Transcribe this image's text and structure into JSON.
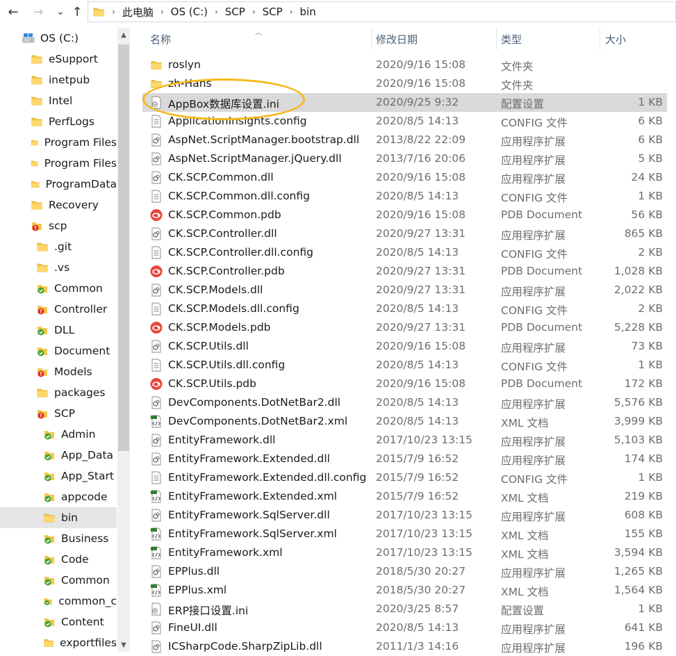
{
  "nav": {
    "back_icon": "←",
    "forward_icon": "→",
    "recent_icon": "⌄",
    "up_icon": "↑"
  },
  "address": {
    "segments": [
      "此电脑",
      "OS (C:)",
      "SCP",
      "SCP",
      "bin"
    ]
  },
  "tree": {
    "items": [
      {
        "label": "OS (C:)",
        "icon": "drive-icon",
        "indent": 0
      },
      {
        "label": "eSupport",
        "icon": "folder-icon",
        "indent": 1
      },
      {
        "label": "inetpub",
        "icon": "folder-icon",
        "indent": 1
      },
      {
        "label": "Intel",
        "icon": "folder-icon",
        "indent": 1
      },
      {
        "label": "PerfLogs",
        "icon": "folder-icon",
        "indent": 1
      },
      {
        "label": "Program Files",
        "icon": "folder-icon",
        "indent": 1
      },
      {
        "label": "Program Files",
        "icon": "folder-icon",
        "indent": 1
      },
      {
        "label": "ProgramData",
        "icon": "folder-icon",
        "indent": 1
      },
      {
        "label": "Recovery",
        "icon": "folder-icon",
        "indent": 1
      },
      {
        "label": "scp",
        "icon": "folder-red-icon",
        "indent": 1
      },
      {
        "label": ".git",
        "icon": "folder-icon",
        "indent": 2
      },
      {
        "label": ".vs",
        "icon": "folder-icon",
        "indent": 2
      },
      {
        "label": "Common",
        "icon": "folder-green-icon",
        "indent": 2
      },
      {
        "label": "Controller",
        "icon": "folder-red-icon",
        "indent": 2
      },
      {
        "label": "DLL",
        "icon": "folder-green-icon",
        "indent": 2
      },
      {
        "label": "Document",
        "icon": "folder-green-icon",
        "indent": 2
      },
      {
        "label": "Models",
        "icon": "folder-red-icon",
        "indent": 2
      },
      {
        "label": "packages",
        "icon": "folder-icon",
        "indent": 2
      },
      {
        "label": "SCP",
        "icon": "folder-red-icon",
        "indent": 2
      },
      {
        "label": "Admin",
        "icon": "folder-green-icon",
        "indent": 3
      },
      {
        "label": "App_Data",
        "icon": "folder-green-icon",
        "indent": 3
      },
      {
        "label": "App_Start",
        "icon": "folder-green-icon",
        "indent": 3
      },
      {
        "label": "appcode",
        "icon": "folder-green-icon",
        "indent": 3
      },
      {
        "label": "bin",
        "icon": "folder-icon",
        "indent": 3,
        "selected": true
      },
      {
        "label": "Business",
        "icon": "folder-green-icon",
        "indent": 3
      },
      {
        "label": "Code",
        "icon": "folder-green-icon",
        "indent": 3
      },
      {
        "label": "Common",
        "icon": "folder-green-icon",
        "indent": 3
      },
      {
        "label": "common_c",
        "icon": "folder-green-icon",
        "indent": 3
      },
      {
        "label": "Content",
        "icon": "folder-green-icon",
        "indent": 3
      },
      {
        "label": "exportfiles",
        "icon": "folder-icon",
        "indent": 3
      }
    ]
  },
  "columns": {
    "name": "名称",
    "date": "修改日期",
    "type": "类型",
    "size": "大小"
  },
  "files": [
    {
      "name": "roslyn",
      "date": "2020/9/16 15:08",
      "type": "文件夹",
      "size": "",
      "icon": "folder-icon"
    },
    {
      "name": "zh-Hans",
      "date": "2020/9/16 15:08",
      "type": "文件夹",
      "size": "",
      "icon": "folder-icon"
    },
    {
      "name": "AppBox数据库设置.ini",
      "date": "2020/9/25 9:32",
      "type": "配置设置",
      "size": "1 KB",
      "icon": "ini-icon",
      "selected": true
    },
    {
      "name": "ApplicationInsights.config",
      "date": "2020/8/5 14:13",
      "type": "CONFIG 文件",
      "size": "6 KB",
      "icon": "file-icon"
    },
    {
      "name": "AspNet.ScriptManager.bootstrap.dll",
      "date": "2013/8/22 22:09",
      "type": "应用程序扩展",
      "size": "6 KB",
      "icon": "dll-icon"
    },
    {
      "name": "AspNet.ScriptManager.jQuery.dll",
      "date": "2013/7/16 20:06",
      "type": "应用程序扩展",
      "size": "5 KB",
      "icon": "dll-icon"
    },
    {
      "name": "CK.SCP.Common.dll",
      "date": "2020/9/16 15:08",
      "type": "应用程序扩展",
      "size": "24 KB",
      "icon": "dll-icon"
    },
    {
      "name": "CK.SCP.Common.dll.config",
      "date": "2020/8/5 14:13",
      "type": "CONFIG 文件",
      "size": "1 KB",
      "icon": "file-icon"
    },
    {
      "name": "CK.SCP.Common.pdb",
      "date": "2020/9/16 15:08",
      "type": "PDB Document",
      "size": "56 KB",
      "icon": "pdb-icon"
    },
    {
      "name": "CK.SCP.Controller.dll",
      "date": "2020/9/27 13:31",
      "type": "应用程序扩展",
      "size": "865 KB",
      "icon": "dll-icon"
    },
    {
      "name": "CK.SCP.Controller.dll.config",
      "date": "2020/8/5 14:13",
      "type": "CONFIG 文件",
      "size": "2 KB",
      "icon": "file-icon"
    },
    {
      "name": "CK.SCP.Controller.pdb",
      "date": "2020/9/27 13:31",
      "type": "PDB Document",
      "size": "1,028 KB",
      "icon": "pdb-icon"
    },
    {
      "name": "CK.SCP.Models.dll",
      "date": "2020/9/27 13:31",
      "type": "应用程序扩展",
      "size": "2,022 KB",
      "icon": "dll-icon"
    },
    {
      "name": "CK.SCP.Models.dll.config",
      "date": "2020/8/5 14:13",
      "type": "CONFIG 文件",
      "size": "2 KB",
      "icon": "file-icon"
    },
    {
      "name": "CK.SCP.Models.pdb",
      "date": "2020/9/27 13:31",
      "type": "PDB Document",
      "size": "5,228 KB",
      "icon": "pdb-icon"
    },
    {
      "name": "CK.SCP.Utils.dll",
      "date": "2020/9/16 15:08",
      "type": "应用程序扩展",
      "size": "73 KB",
      "icon": "dll-icon"
    },
    {
      "name": "CK.SCP.Utils.dll.config",
      "date": "2020/8/5 14:13",
      "type": "CONFIG 文件",
      "size": "1 KB",
      "icon": "file-icon"
    },
    {
      "name": "CK.SCP.Utils.pdb",
      "date": "2020/9/16 15:08",
      "type": "PDB Document",
      "size": "172 KB",
      "icon": "pdb-icon"
    },
    {
      "name": "DevComponents.DotNetBar2.dll",
      "date": "2020/8/5 14:13",
      "type": "应用程序扩展",
      "size": "5,576 KB",
      "icon": "dll-icon"
    },
    {
      "name": "DevComponents.DotNetBar2.xml",
      "date": "2020/8/5 14:13",
      "type": "XML 文档",
      "size": "3,999 KB",
      "icon": "xml-icon"
    },
    {
      "name": "EntityFramework.dll",
      "date": "2017/10/23 13:15",
      "type": "应用程序扩展",
      "size": "5,103 KB",
      "icon": "dll-icon"
    },
    {
      "name": "EntityFramework.Extended.dll",
      "date": "2015/7/9 16:52",
      "type": "应用程序扩展",
      "size": "174 KB",
      "icon": "dll-icon"
    },
    {
      "name": "EntityFramework.Extended.dll.config",
      "date": "2015/7/9 16:52",
      "type": "CONFIG 文件",
      "size": "1 KB",
      "icon": "file-icon"
    },
    {
      "name": "EntityFramework.Extended.xml",
      "date": "2015/7/9 16:52",
      "type": "XML 文档",
      "size": "219 KB",
      "icon": "xml-icon"
    },
    {
      "name": "EntityFramework.SqlServer.dll",
      "date": "2017/10/23 13:15",
      "type": "应用程序扩展",
      "size": "608 KB",
      "icon": "dll-icon"
    },
    {
      "name": "EntityFramework.SqlServer.xml",
      "date": "2017/10/23 13:15",
      "type": "XML 文档",
      "size": "155 KB",
      "icon": "xml-icon"
    },
    {
      "name": "EntityFramework.xml",
      "date": "2017/10/23 13:15",
      "type": "XML 文档",
      "size": "3,594 KB",
      "icon": "xml-icon"
    },
    {
      "name": "EPPlus.dll",
      "date": "2018/5/30 20:27",
      "type": "应用程序扩展",
      "size": "1,265 KB",
      "icon": "dll-icon"
    },
    {
      "name": "EPPlus.xml",
      "date": "2018/5/30 20:27",
      "type": "XML 文档",
      "size": "1,564 KB",
      "icon": "xml-icon"
    },
    {
      "name": "ERP接口设置.ini",
      "date": "2020/3/25 8:57",
      "type": "配置设置",
      "size": "1 KB",
      "icon": "ini-icon"
    },
    {
      "name": "FineUI.dll",
      "date": "2020/8/5 14:13",
      "type": "应用程序扩展",
      "size": "641 KB",
      "icon": "dll-icon"
    },
    {
      "name": "ICSharpCode.SharpZipLib.dll",
      "date": "2011/1/3 14:16",
      "type": "应用程序扩展",
      "size": "196 KB",
      "icon": "dll-icon"
    }
  ]
}
